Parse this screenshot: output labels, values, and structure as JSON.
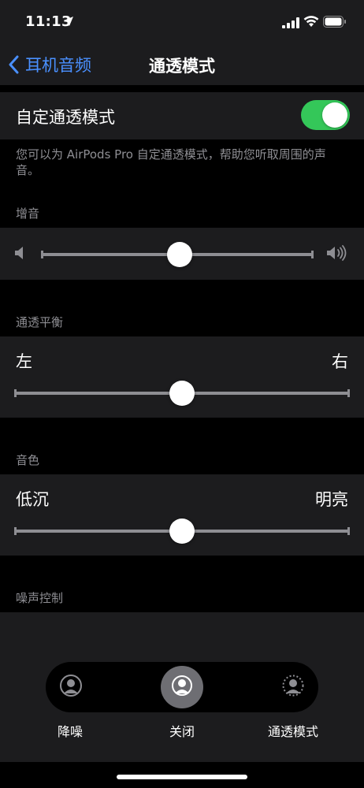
{
  "status_bar": {
    "time": "11:13"
  },
  "nav": {
    "back_label": "耳机音频",
    "title": "通透模式"
  },
  "custom_mode": {
    "label": "自定通透模式",
    "enabled": true,
    "footer": "您可以为 AirPods Pro 自定通透模式，帮助您听取周围的声音。"
  },
  "amplification": {
    "header": "增音",
    "value": 0.51
  },
  "balance": {
    "header": "通透平衡",
    "left_label": "左",
    "right_label": "右",
    "value": 0.5
  },
  "tone": {
    "header": "音色",
    "left_label": "低沉",
    "right_label": "明亮",
    "value": 0.5
  },
  "noise_control": {
    "header": "噪声控制",
    "options": [
      {
        "label": "降噪",
        "icon": "noise-cancellation-icon",
        "selected": false
      },
      {
        "label": "关闭",
        "icon": "off-icon",
        "selected": true
      },
      {
        "label": "通透模式",
        "icon": "transparency-icon",
        "selected": false
      }
    ]
  },
  "colors": {
    "accent": "#4a90ff",
    "toggle_on": "#34c759",
    "group_bg": "#1c1c1e",
    "secondary_text": "#8e8e93"
  }
}
